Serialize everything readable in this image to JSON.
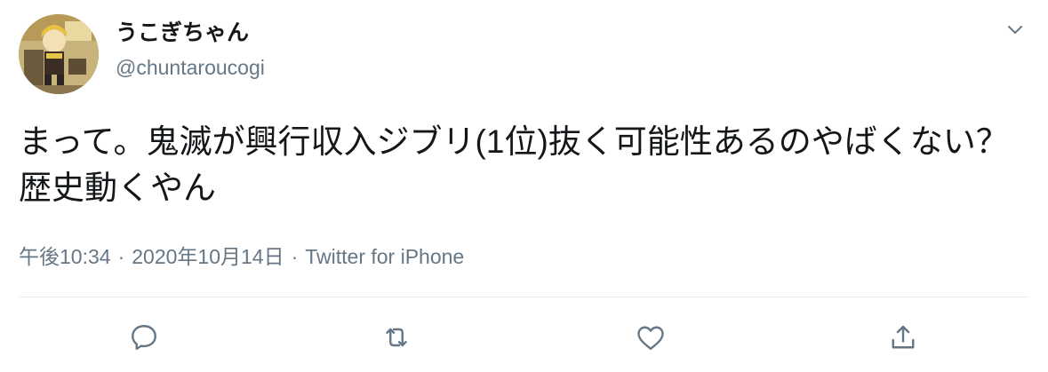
{
  "user": {
    "display_name": "うこぎちゃん",
    "handle": "@chuntaroucogi",
    "avatar_icon": "avatar-figure-photo"
  },
  "tweet": {
    "text": "まって。鬼滅が興行収入ジブリ(1位)抜く可能性あるのやばくない？歴史動くやん",
    "time": "午後10:34",
    "date": "2020年10月14日",
    "separator": "·",
    "source": "Twitter for iPhone"
  },
  "header": {
    "menu_icon": "chevron-down-icon"
  },
  "actions": {
    "reply_icon": "reply-icon",
    "retweet_icon": "retweet-icon",
    "like_icon": "heart-icon",
    "share_icon": "share-icon"
  },
  "colors": {
    "text_primary": "#14171a",
    "text_secondary": "#657786",
    "icon": "#657786",
    "divider": "#e6ecf0"
  }
}
